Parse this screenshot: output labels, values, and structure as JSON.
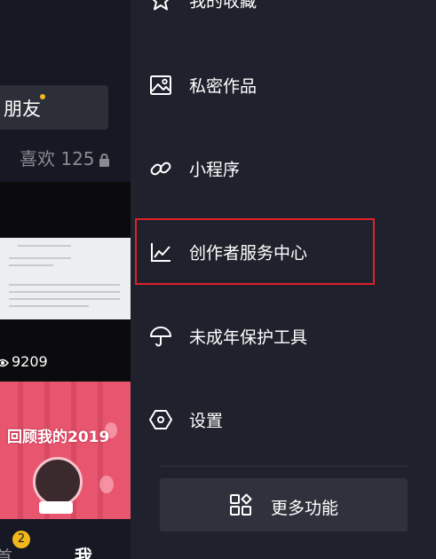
{
  "background_profile": {
    "friend_button_label": "朋友",
    "likes_label": "喜欢 125",
    "video_views": "9209",
    "video_title": "回顾我的2019",
    "notification_count": "2",
    "nav_me_label": "我",
    "nav_home_label": "首"
  },
  "drawer": {
    "items": [
      {
        "label": "我的收藏",
        "icon": "star-icon"
      },
      {
        "label": "私密作品",
        "icon": "image-icon"
      },
      {
        "label": "小程序",
        "icon": "link-icon"
      },
      {
        "label": "创作者服务中心",
        "icon": "chart-line-icon",
        "highlighted": true
      },
      {
        "label": "未成年保护工具",
        "icon": "umbrella-icon"
      },
      {
        "label": "设置",
        "icon": "hexagon-settings-icon"
      }
    ],
    "more_button_label": "更多功能",
    "more_button_icon": "grid-shapes-icon"
  },
  "colors": {
    "drawer_bg": "#1f222c",
    "highlight_border": "#e0202a",
    "badge": "#f2b71c",
    "video_pink": "#e7566e"
  }
}
